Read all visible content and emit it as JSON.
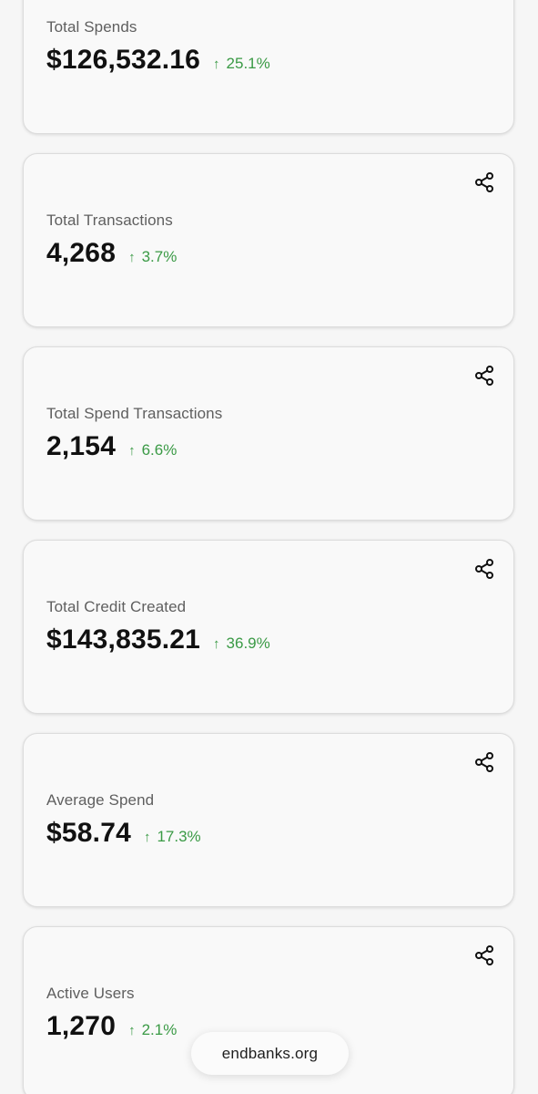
{
  "colors": {
    "positive": "#3a9a45",
    "label": "#5f5f5f",
    "value": "#111111"
  },
  "icons": {
    "share": "share-icon",
    "arrow": "arrow-up-icon"
  },
  "cards": [
    {
      "label": "Total Spends",
      "value": "$126,532.16",
      "change": "25.1%",
      "arrow": "↑"
    },
    {
      "label": "Total Transactions",
      "value": "4,268",
      "change": "3.7%",
      "arrow": "↑"
    },
    {
      "label": "Total Spend Transactions",
      "value": "2,154",
      "change": "6.6%",
      "arrow": "↑"
    },
    {
      "label": "Total Credit Created",
      "value": "$143,835.21",
      "change": "36.9%",
      "arrow": "↑"
    },
    {
      "label": "Average Spend",
      "value": "$58.74",
      "change": "17.3%",
      "arrow": "↑"
    },
    {
      "label": "Active Users",
      "value": "1,270",
      "change": "2.1%",
      "arrow": "↑"
    }
  ],
  "footer": {
    "domain": "endbanks.org"
  }
}
